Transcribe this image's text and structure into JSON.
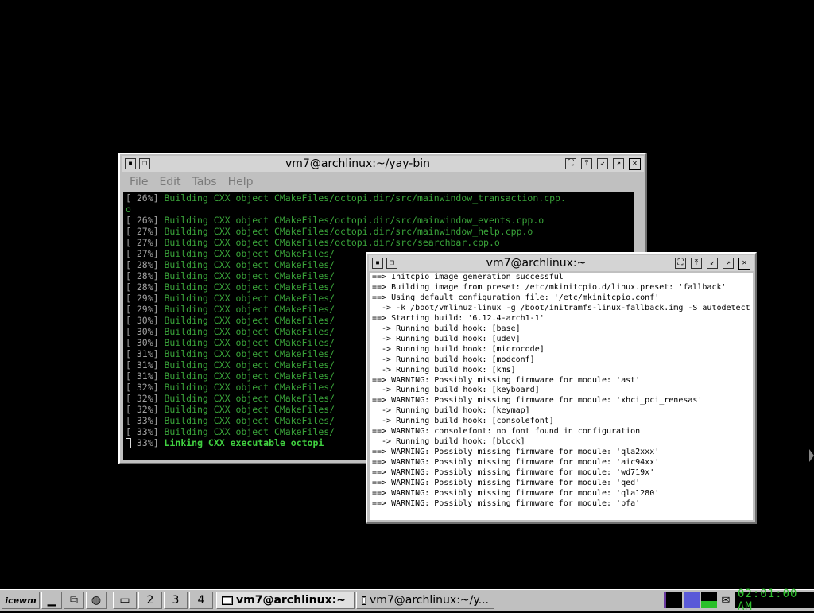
{
  "window_back": {
    "title": "vm7@archlinux:~/yay-bin",
    "menu": [
      "File",
      "Edit",
      "Tabs",
      "Help"
    ],
    "lines": [
      {
        "pct": "[ 26%]",
        "text": " Building CXX object CMakeFiles/octopi.dir/src/mainwindow_transaction.cpp."
      },
      {
        "pct": "o",
        "text": ""
      },
      {
        "pct": "[ 26%]",
        "text": " Building CXX object CMakeFiles/octopi.dir/src/mainwindow_events.cpp.o"
      },
      {
        "pct": "[ 27%]",
        "text": " Building CXX object CMakeFiles/octopi.dir/src/mainwindow_help.cpp.o"
      },
      {
        "pct": "[ 27%]",
        "text": " Building CXX object CMakeFiles/octopi.dir/src/searchbar.cpp.o"
      },
      {
        "pct": "[ 27%]",
        "text": " Building CXX object CMakeFiles/"
      },
      {
        "pct": "[ 28%]",
        "text": " Building CXX object CMakeFiles/"
      },
      {
        "pct": "[ 28%]",
        "text": " Building CXX object CMakeFiles/"
      },
      {
        "pct": "[ 28%]",
        "text": " Building CXX object CMakeFiles/"
      },
      {
        "pct": "[ 29%]",
        "text": " Building CXX object CMakeFiles/"
      },
      {
        "pct": "[ 29%]",
        "text": " Building CXX object CMakeFiles/"
      },
      {
        "pct": "[ 30%]",
        "text": " Building CXX object CMakeFiles/"
      },
      {
        "pct": "[ 30%]",
        "text": " Building CXX object CMakeFiles/"
      },
      {
        "pct": "[ 30%]",
        "text": " Building CXX object CMakeFiles/"
      },
      {
        "pct": "[ 31%]",
        "text": " Building CXX object CMakeFiles/"
      },
      {
        "pct": "[ 31%]",
        "text": " Building CXX object CMakeFiles/"
      },
      {
        "pct": "[ 31%]",
        "text": " Building CXX object CMakeFiles/"
      },
      {
        "pct": "[ 32%]",
        "text": " Building CXX object CMakeFiles/"
      },
      {
        "pct": "[ 32%]",
        "text": " Building CXX object CMakeFiles/"
      },
      {
        "pct": "[ 32%]",
        "text": " Building CXX object CMakeFiles/"
      },
      {
        "pct": "[ 33%]",
        "text": " Building CXX object CMakeFiles/"
      },
      {
        "pct": "[ 33%]",
        "text": " Building CXX object CMakeFiles/"
      }
    ],
    "last_line": {
      "pct": " 33%]",
      "text": " Linking CXX executable octopi"
    }
  },
  "window_front": {
    "title": "vm7@archlinux:~",
    "lines": [
      "==> Initcpio image generation successful",
      "==> Building image from preset: /etc/mkinitcpio.d/linux.preset: 'fallback'",
      "==> Using default configuration file: '/etc/mkinitcpio.conf'",
      "  -> -k /boot/vmlinuz-linux -g /boot/initramfs-linux-fallback.img -S autodetect",
      "==> Starting build: '6.12.4-arch1-1'",
      "  -> Running build hook: [base]",
      "  -> Running build hook: [udev]",
      "  -> Running build hook: [microcode]",
      "  -> Running build hook: [modconf]",
      "  -> Running build hook: [kms]",
      "==> WARNING: Possibly missing firmware for module: 'ast'",
      "  -> Running build hook: [keyboard]",
      "==> WARNING: Possibly missing firmware for module: 'xhci_pci_renesas'",
      "  -> Running build hook: [keymap]",
      "  -> Running build hook: [consolefont]",
      "==> WARNING: consolefont: no font found in configuration",
      "  -> Running build hook: [block]",
      "==> WARNING: Possibly missing firmware for module: 'qla2xxx'",
      "==> WARNING: Possibly missing firmware for module: 'aic94xx'",
      "==> WARNING: Possibly missing firmware for module: 'wd719x'",
      "==> WARNING: Possibly missing firmware for module: 'qed'",
      "==> WARNING: Possibly missing firmware for module: 'qla1280'",
      "==> WARNING: Possibly missing firmware for module: 'bfa'"
    ]
  },
  "taskbar": {
    "logo": "icewm",
    "workspaces": [
      "2",
      "3",
      "4"
    ],
    "tasks": [
      {
        "label": "vm7@archlinux:~",
        "active": true
      },
      {
        "label": "vm7@archlinux:~/y...",
        "active": false
      }
    ],
    "clock": "02:01:00 AM"
  },
  "colors": {
    "desktop": "#000000",
    "terminal_green": "#3aa53a",
    "clock_green": "#30c030"
  }
}
